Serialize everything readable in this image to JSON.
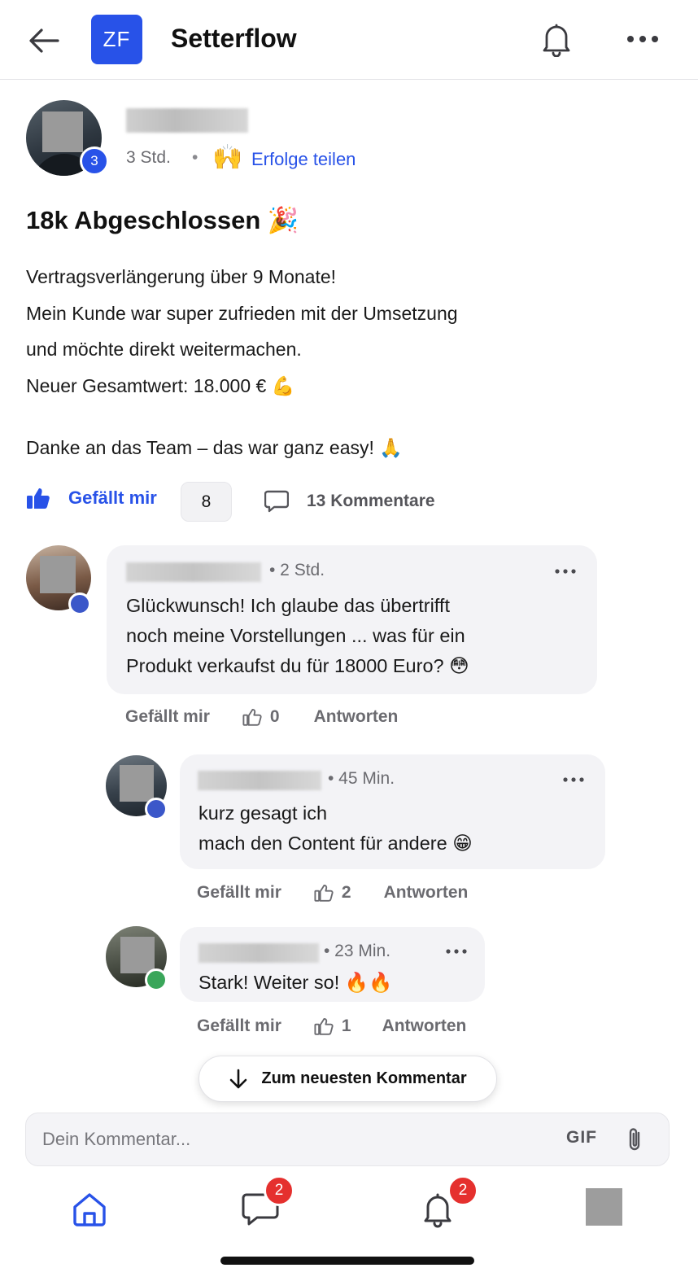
{
  "header": {
    "logo_text": "ZF",
    "title": "Setterflow",
    "accent_color": "#2852e8",
    "icons": {
      "back": "arrow-left-icon",
      "bell": "bell-icon",
      "more": "more-horizontal-icon"
    }
  },
  "post": {
    "author_level": "3",
    "time": "3 Std.",
    "separator": "•",
    "category_emoji": "🙌",
    "category": "Erfolge teilen",
    "title": "18k Abgeschlossen 🎉",
    "body_lines": [
      "Vertragsverlängerung über 9 Monate!",
      "Mein Kunde war super zufrieden mit der Umsetzung",
      "und möchte direkt weitermachen.",
      "Neuer Gesamtwert: 18.000 € 💪"
    ],
    "body_closing": "Danke an das Team – das war ganz easy! 🙏",
    "like_label": "Gefällt mir",
    "like_count": "8",
    "comments_label": "13 Kommentare"
  },
  "comments": [
    {
      "time": "• 2 Std.",
      "text_lines": [
        "Glückwunsch! Ich glaube das übertrifft",
        "noch meine Vorstellungen ... was für ein",
        "Produkt verkaufst du für 18000 Euro? 😳"
      ],
      "like_label": "Gefällt mir",
      "likes": "0",
      "reply_label": "Antworten",
      "status_color": "#3b57c9"
    },
    {
      "time": "• 45 Min.",
      "text_lines": [
        "kurz gesagt ich",
        "mach den Content für andere 😁"
      ],
      "like_label": "Gefällt mir",
      "likes": "2",
      "reply_label": "Antworten",
      "status_color": "#3b57c9"
    },
    {
      "time": "• 23 Min.",
      "text_lines": [
        "Stark! Weiter so! 🔥🔥"
      ],
      "like_label": "Gefällt mir",
      "likes": "1",
      "reply_label": "Antworten",
      "status_color": "#3aa65a"
    }
  ],
  "jump_button": {
    "label": "Zum neuesten Kommentar",
    "icon": "arrow-down-icon"
  },
  "composer": {
    "placeholder": "Dein Kommentar...",
    "gif_label": "GIF",
    "attach_icon": "paperclip-icon"
  },
  "tabbar": {
    "home_icon": "home-icon",
    "chat_icon": "chat-bubble-icon",
    "chat_badge": "2",
    "notifications_icon": "bell-icon",
    "notifications_badge": "2",
    "badge_color": "#e5302e"
  }
}
